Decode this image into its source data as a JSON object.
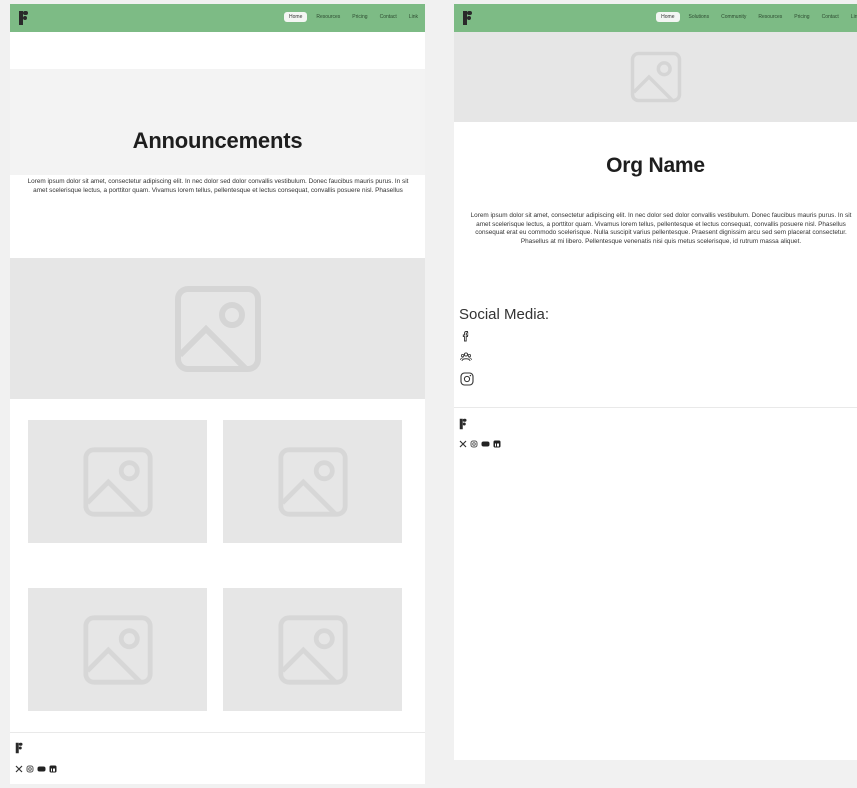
{
  "left": {
    "nav": [
      "Home",
      "Resources",
      "Pricing",
      "Contact",
      "Link"
    ],
    "hero_title": "Announcements",
    "body": "Lorem ipsum dolor sit amet, consectetur adipiscing elit. In nec dolor sed dolor convallis vestibulum. Donec faucibus mauris purus. In sit amet scelerisque lectus, a porttitor quam. Vivamus lorem tellus, pellentesque et lectus consequat, convallis posuere nisl. Phasellus"
  },
  "right": {
    "nav": [
      "Home",
      "Solutions",
      "Community",
      "Resources",
      "Pricing",
      "Contact",
      "Link"
    ],
    "title": "Org Name",
    "body": "Lorem ipsum dolor sit amet, consectetur adipiscing elit. In nec dolor sed dolor convallis vestibulum. Donec faucibus mauris purus. In sit amet scelerisque lectus, a porttitor quam. Vivamus lorem tellus, pellentesque et lectus consequat, convallis posuere nisl. Phasellus consequat erat eu commodo scelerisque. Nulla suscipit varius pellentesque. Praesent dignissim arcu sed sem placerat consectetur. Phasellus at mi libero. Pellentesque venenatis nisi quis metus scelerisque, id rutrum massa aliquet.",
    "social_title": "Social Media:",
    "social_icons": [
      "facebook-icon",
      "group-icon",
      "instagram-icon"
    ]
  },
  "footer_icons": [
    "x-icon",
    "instagram-icon",
    "youtube-icon",
    "linkedin-icon"
  ],
  "colors": {
    "nav_bg": "#7dbb85",
    "placeholder": "#e6e6e6"
  }
}
